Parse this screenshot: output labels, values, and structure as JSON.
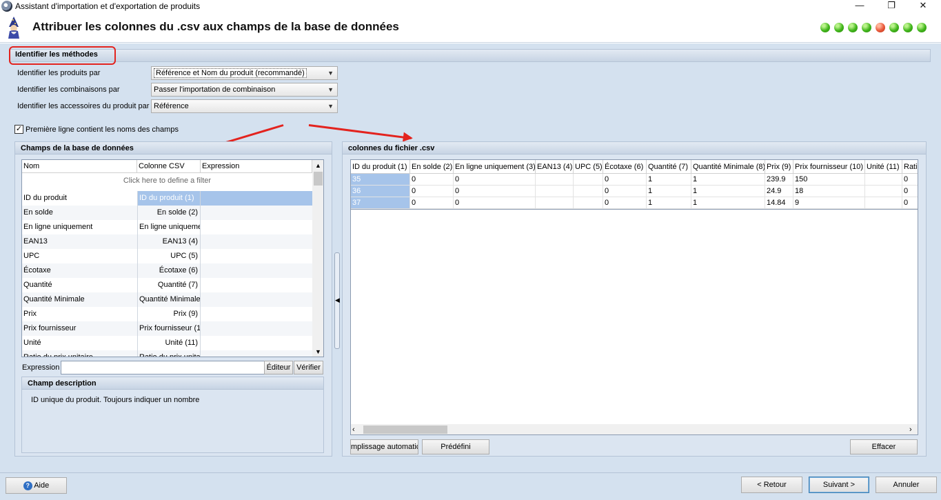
{
  "window": {
    "title": "Assistant d'importation et d'exportation de produits",
    "minimize_glyph": "—",
    "restore_glyph": "❐",
    "close_glyph": "✕"
  },
  "header": {
    "title": "Attribuer les colonnes du .csv aux champs de la base de données",
    "progress_dots": [
      "green",
      "green",
      "green",
      "green",
      "red",
      "green",
      "green",
      "green"
    ]
  },
  "methods": {
    "section_title": "Identifier les méthodes",
    "rows": [
      {
        "label": "Identifier les produits par",
        "value": "Référence et Nom du produit (recommandé)"
      },
      {
        "label": "Identifier les combinaisons par",
        "value": "Passer l'importation de combinaison"
      },
      {
        "label": "Identifier les accessoires du produit par",
        "value": "Référence"
      }
    ],
    "first_line_checkbox": {
      "label": "Première ligne contient les noms des champs",
      "checked": true
    }
  },
  "db_fields": {
    "section_title": "Champs de la base de données",
    "columns": [
      "Nom",
      "Colonne CSV",
      "Expression"
    ],
    "filter_placeholder": "Click here to define a filter",
    "rows": [
      {
        "name": "ID du produit",
        "csv": "ID du produit (1)",
        "expr": "",
        "selected": true
      },
      {
        "name": "En solde",
        "csv": "En solde (2)",
        "expr": ""
      },
      {
        "name": "En ligne uniquement",
        "csv": "En ligne uniquemer",
        "expr": ""
      },
      {
        "name": "EAN13",
        "csv": "EAN13 (4)",
        "expr": ""
      },
      {
        "name": "UPC",
        "csv": "UPC (5)",
        "expr": ""
      },
      {
        "name": "Écotaxe",
        "csv": "Écotaxe (6)",
        "expr": ""
      },
      {
        "name": "Quantité",
        "csv": "Quantité (7)",
        "expr": ""
      },
      {
        "name": "Quantité Minimale",
        "csv": "Quantité Minimale",
        "expr": ""
      },
      {
        "name": "Prix",
        "csv": "Prix (9)",
        "expr": ""
      },
      {
        "name": "Prix fournisseur",
        "csv": "Prix fournisseur (1",
        "expr": ""
      },
      {
        "name": "Unité",
        "csv": "Unité (11)",
        "expr": ""
      },
      {
        "name": "Ratio du prix unitaire",
        "csv": "Ratio du prix unita",
        "expr": ""
      }
    ],
    "expression_label": "Expression",
    "editor_button": "Éditeur",
    "verify_button": "Vérifier",
    "description_title": "Champ description",
    "description_text": "ID unique du produit. Toujours indiquer un nombre"
  },
  "csv": {
    "section_title": "colonnes du fichier .csv",
    "columns": [
      "ID du produit (1)",
      "En solde (2)",
      "En ligne uniquement (3)",
      "EAN13 (4)",
      "UPC (5)",
      "Écotaxe (6)",
      "Quantité (7)",
      "Quantité Minimale (8)",
      "Prix (9)",
      "Prix fournisseur (10)",
      "Unité (11)",
      "Rati"
    ],
    "rows": [
      [
        "35",
        "0",
        "0",
        "",
        "",
        "0",
        "1",
        "1",
        "239.9",
        "150",
        "",
        "0"
      ],
      [
        "36",
        "0",
        "0",
        "",
        "",
        "0",
        "1",
        "1",
        "24.9",
        "18",
        "",
        "0"
      ],
      [
        "37",
        "0",
        "0",
        "",
        "",
        "0",
        "1",
        "1",
        "14.84",
        "9",
        "",
        "0"
      ]
    ],
    "auto_fill_button": "mplissage automatic",
    "predefined_button": "Prédéfini",
    "clear_button": "Effacer"
  },
  "footer": {
    "help_button": "Aide",
    "back_button": "< Retour",
    "next_button": "Suivant >",
    "cancel_button": "Annuler"
  },
  "colors": {
    "panel_bg": "#d4e1ef",
    "selection": "#a6c4ea",
    "annotation_red": "#e3231e"
  }
}
